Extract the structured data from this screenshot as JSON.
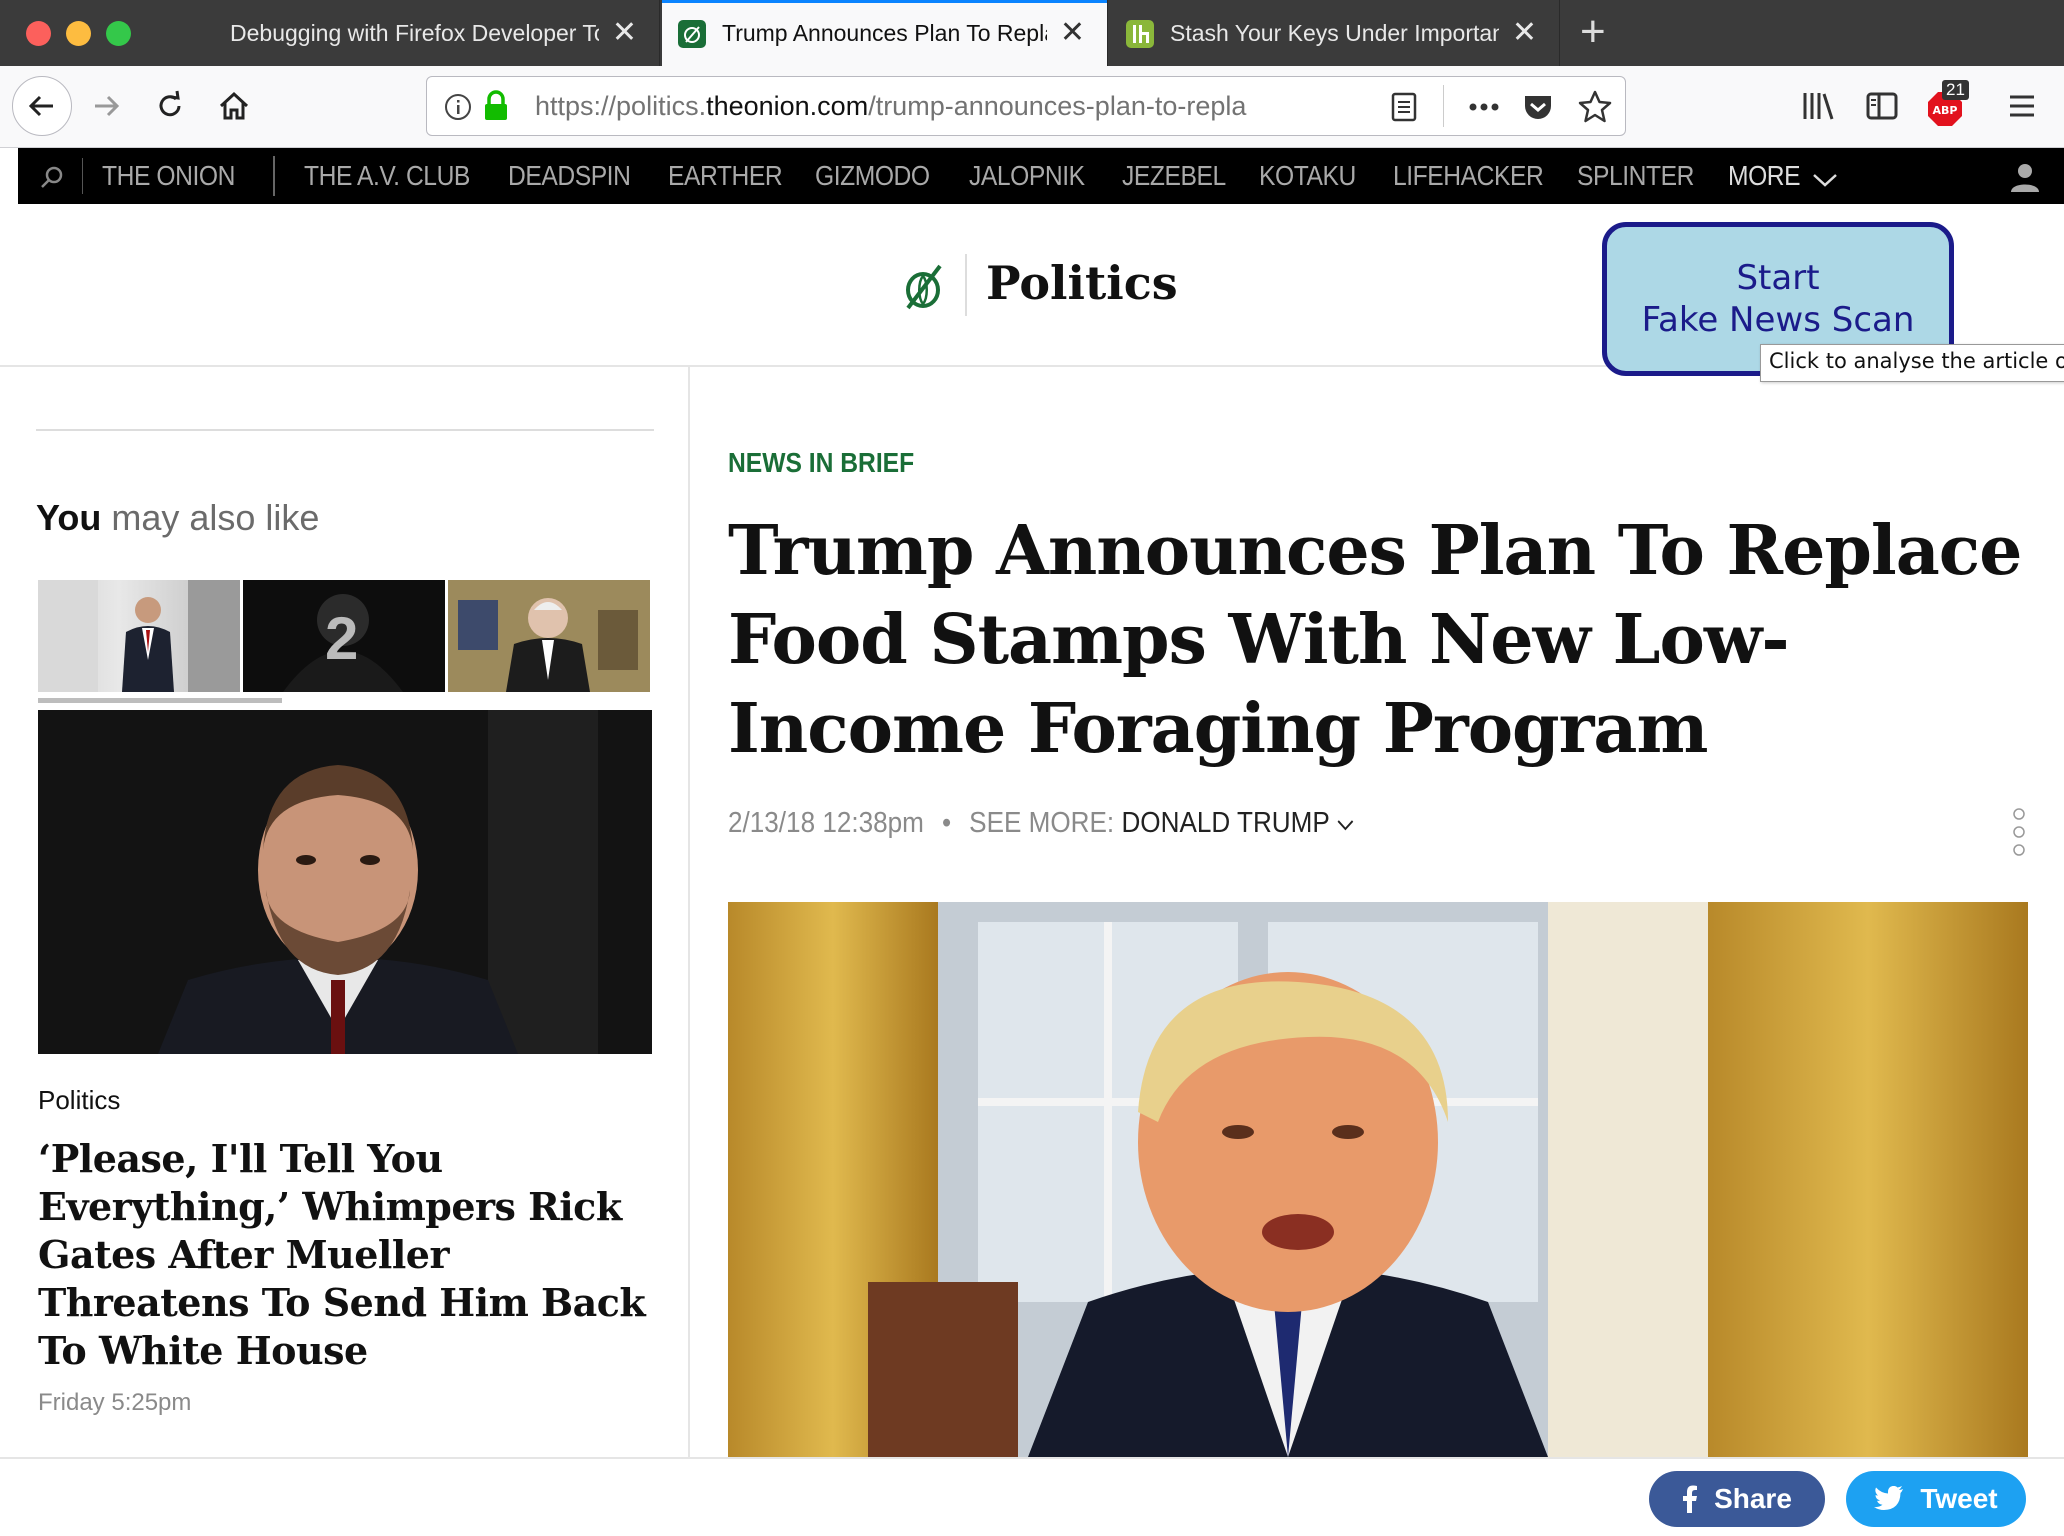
{
  "browser": {
    "tabs": [
      {
        "title": "Debugging with Firefox Developer Tools",
        "active": false
      },
      {
        "title": "Trump Announces Plan To Replace Food Stamps",
        "active": true
      },
      {
        "title": "Stash Your Keys Under Important Paper",
        "active": false
      }
    ],
    "url_prefix": "https://politics.",
    "url_domain": "theonion.com",
    "url_path": "/trump-announces-plan-to-repla",
    "adblock_count": "21",
    "colors": {
      "tabbar": "#3b3b3b",
      "active_tab_accent": "#0a84ff",
      "secure_lock": "#12bc00",
      "adblock": "#e2121d"
    }
  },
  "network_bar": {
    "items": [
      "THE ONION",
      "THE A.V. CLUB",
      "DEADSPIN",
      "EARTHER",
      "GIZMODO",
      "JALOPNIK",
      "JEZEBEL",
      "KOTAKU",
      "LIFEHACKER",
      "SPLINTER",
      "MORE"
    ]
  },
  "header": {
    "section": "Politics",
    "scan_button_line1": "Start",
    "scan_button_line2": "Fake News Scan",
    "tooltip": "Click to analyse the article on"
  },
  "sidebar": {
    "heading_bold": "You",
    "heading_rest": " may also like",
    "carousel_number": "2",
    "feature": {
      "section": "Politics",
      "headline": "‘Please, I'll Tell You Everything,’ Whimpers Rick Gates After Mueller Threatens To Send Him Back To White House",
      "time": "Friday 5:25pm"
    }
  },
  "article": {
    "kicker": "News in Brief",
    "headline": "Trump Announces Plan To Replace Food Stamps With New Low-Income Foraging Program",
    "timestamp": "2/13/18 12:38pm",
    "see_more_label": "SEE MORE:",
    "tag": "DONALD TRUMP",
    "brand_green": "#1a6e37"
  },
  "share": {
    "facebook_label": "Share",
    "twitter_label": "Tweet",
    "facebook_color": "#3b5998",
    "twitter_color": "#1da1f2"
  }
}
